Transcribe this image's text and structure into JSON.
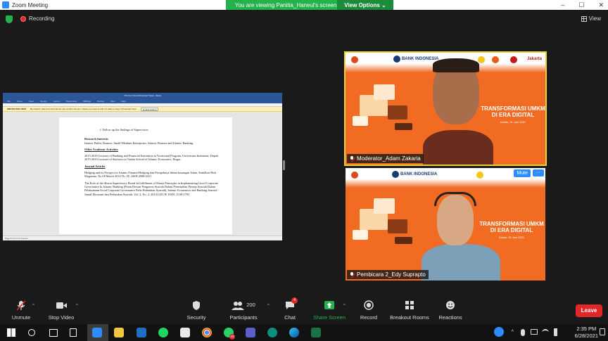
{
  "window": {
    "title": "Zoom Meeting",
    "controls": [
      "–",
      "☐",
      "✕"
    ]
  },
  "share_banner": {
    "viewing_text": "You are viewing Panitia_Haneul's screen",
    "view_options": "View Options ⌄"
  },
  "status": {
    "recording": "Recording",
    "view": "View"
  },
  "shared_screen": {
    "word_title": "Info For Unit 3 (Protected View) - Word",
    "word_tabs": [
      "File",
      "Home",
      "Insert",
      "Design",
      "Layout",
      "References",
      "Mailings",
      "Review",
      "View",
      "Help"
    ],
    "protected_label": "PROTECTED VIEW",
    "protected_text": "Be careful - files from the Internet can contain viruses. Unless you need to edit, it's safer to stay in Protected View.",
    "protected_button": "Enable Editing",
    "doc": {
      "item": "f.   Follow up the findings of Supervisors",
      "research_heading": "Research Interests",
      "research_text": "Islamic Public Finance, Small-Medium Enterprises, Islamic Finance and Islamic Banking.",
      "other_heading": "Other Academic Activities",
      "other_1": "2015-2016 Lecturer of Banking and Financial Institution at Vocational Program, Universitas Indonesia, Depok",
      "other_2": "2015-2016 Lecturer of Statistics at Tazkia School of Islamic Economics, Bogor.",
      "journal_heading": "Journal Articles",
      "journal_1": "Hedging and its Prospect in Islamic Finance/Hedging dan Prospeknya dalam keuangan Islam, Stabilitas Risk Magazine, No 08 March 2014 Th. IX, ISSN 2088-0411",
      "journal_2": "The Role of the Sharia Supervisory Board In fulfillment of Sharia Principles in Implementing Good Corporate Governance In Islamic Banking (Peran Dewan Pengawas Syariah Dalam Pemenuhan Prinsip Syariah Dalam Pelaksanaan Good Corporate Governance Pada Perbankan Syariah), Islamic Economics and Banking Journal / Jurnal Ekonomi dan Perbankan Syariah, Vol. 2, No. 2, 2014/1435 H. ISSN: 2338-2783"
    },
    "status_bar": "Page 8 of 9    3 of 3 words"
  },
  "participants": [
    {
      "name": "Moderator_Adam Zakaria",
      "bank": "BANK INDONESIA",
      "banner": [
        "TRANSFORMASI UMKM",
        "DI ERA DIGITAL"
      ],
      "date": "Kamis, 24 Juni 2021",
      "sponsor": "Jakarta"
    },
    {
      "name": "Pembicara 2_Edy Suprapto",
      "bank": "BANK INDONESIA",
      "banner": [
        "TRANSFORMASI UMKM",
        "DI ERA DIGITAL"
      ],
      "date": "Kamis, 24 Juni 2021",
      "mute_label": "Mute",
      "more_label": "···"
    }
  ],
  "toolbar": {
    "unmute": "Unmute",
    "stop_video": "Stop Video",
    "security": "Security",
    "participants": "Participants",
    "participant_count": "200",
    "chat": "Chat",
    "chat_badge": "4",
    "share_screen": "Share Screen",
    "record": "Record",
    "breakout_rooms": "Breakout Rooms",
    "reactions": "Reactions",
    "leave": "Leave"
  },
  "taskbar": {
    "whatsapp_badge": "43",
    "time": "2:35 PM",
    "date": "6/28/2021"
  },
  "colors": {
    "zoom_blue": "#2d8cff",
    "share_green": "#23b24b",
    "leave_red": "#e02828",
    "speaker_border": "#e8d33b",
    "brand_orange": "#f26b22"
  }
}
